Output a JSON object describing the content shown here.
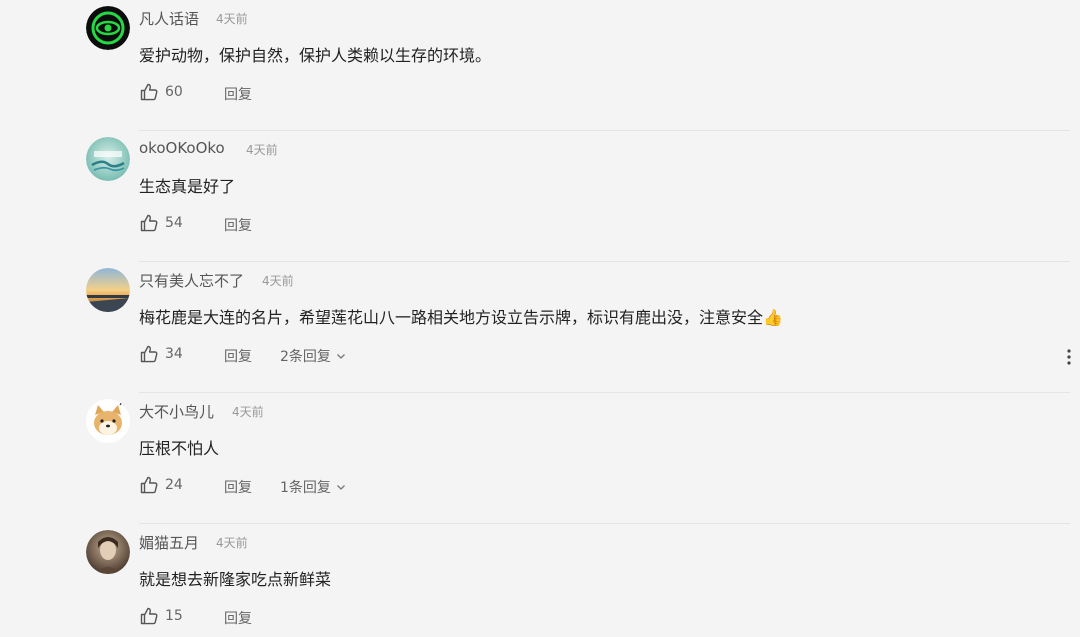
{
  "comments": [
    {
      "author": "凡人话语",
      "time": "4天前",
      "text": "爱护动物，保护自然，保护人类赖以生存的环境。",
      "likes": "60",
      "reply_label": "回复",
      "reply_count": "",
      "avatar": "green-eye-icon"
    },
    {
      "author": "okoOKoOko",
      "time": "4天前",
      "text": "生态真是好了",
      "likes": "54",
      "reply_label": "回复",
      "reply_count": "",
      "avatar": "future-badge"
    },
    {
      "author": "只有美人忘不了",
      "time": "4天前",
      "text": "梅花鹿是大连的名片，希望莲花山八一路相关地方设立告示牌，标识有鹿出没，注意安全👍",
      "likes": "34",
      "reply_label": "回复",
      "reply_count": "2条回复",
      "avatar": "sunset-landscape"
    },
    {
      "author": "大不小鸟儿",
      "time": "4天前",
      "text": "压根不怕人",
      "likes": "24",
      "reply_label": "回复",
      "reply_count": "1条回复",
      "avatar": "shiba-dog"
    },
    {
      "author": "媚猫五月",
      "time": "4天前",
      "text": "就是想去新隆家吃点新鲜菜",
      "likes": "15",
      "reply_label": "回复",
      "reply_count": "",
      "avatar": "portrait-photo"
    }
  ]
}
